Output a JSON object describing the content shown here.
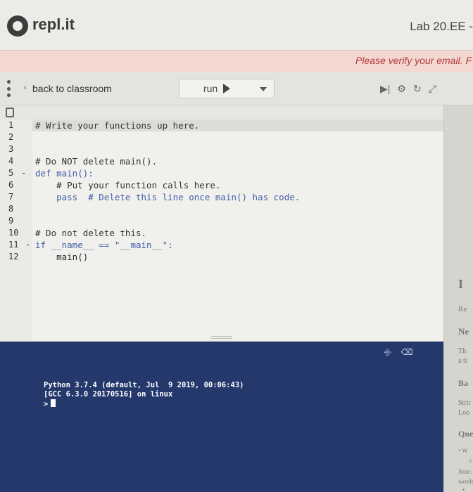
{
  "header": {
    "logo_text": "repl.it",
    "lab_title": "Lab 20.EE -",
    "verify_text": "Please verify your email. F"
  },
  "toolbar": {
    "back_label": "back to classroom",
    "back_chevron": "‹",
    "run_label": "run",
    "icons": [
      "step-icon",
      "settings-icon",
      "refresh-icon",
      "expand-icon"
    ]
  },
  "editor": {
    "line_numbers": [
      "1",
      "2",
      "3",
      "4",
      "5",
      "6",
      "7",
      "8",
      "9",
      "10",
      "11",
      "12"
    ],
    "lines": [
      "# Write your functions up here.",
      "",
      "",
      "# Do NOT delete main().",
      "def main():",
      "    # Put your function calls here.",
      "    pass  # Delete this line once main() has code.",
      "",
      "",
      "# Do not delete this.",
      "if __name__ == \"__main__\":",
      "    main()"
    ],
    "fold_markers": {
      "5": "-",
      "11": "-"
    }
  },
  "console": {
    "lines": [
      "Python 3.7.4 (default, Jul  9 2019, 00:06:43)",
      "[GCC 6.3.0 20170516] on linux",
      ">"
    ]
  },
  "right_strip": {
    "fragments": [
      "I",
      "Re",
      "Ne",
      "Th",
      "a ti",
      "Ba",
      "Strir",
      "Loo",
      "Que",
      "• W",
      "c",
      "Note:",
      "words",
      "•"
    ]
  },
  "colors": {
    "console_bg": "#25386c",
    "verify_bg": "#f3d7d0",
    "verify_text": "#b23a3a",
    "keyword": "#3f5fa8"
  }
}
